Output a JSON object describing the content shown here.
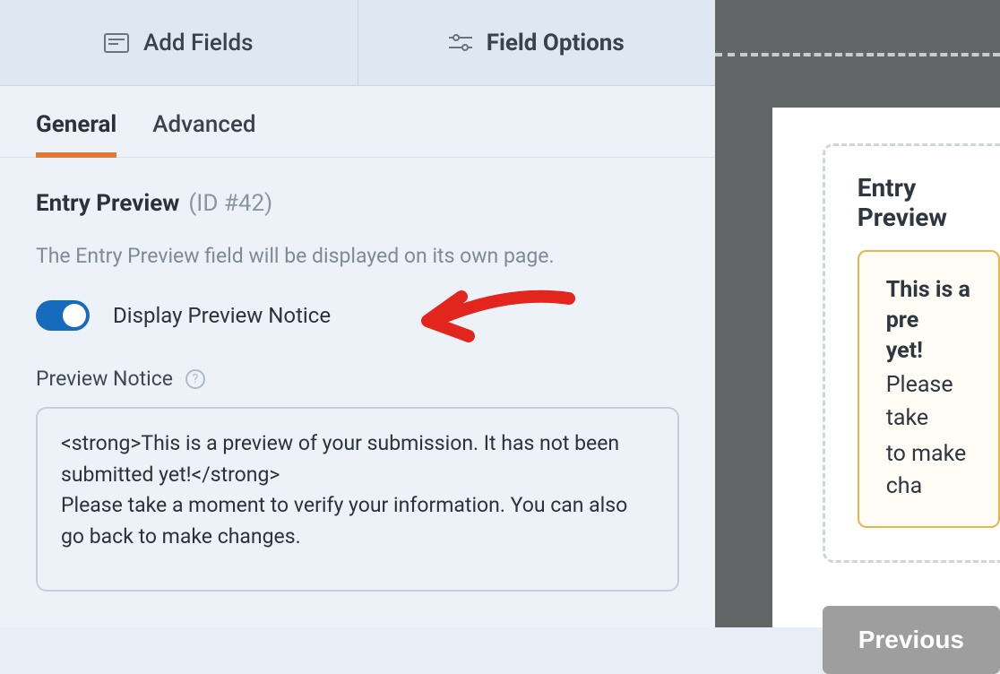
{
  "top_tabs": {
    "add_fields": "Add Fields",
    "field_options": "Field Options"
  },
  "sub_tabs": {
    "general": "General",
    "advanced": "Advanced"
  },
  "section": {
    "title": "Entry Preview",
    "id_label": "(ID #42)"
  },
  "description": "The Entry Preview field will be displayed on its own page.",
  "toggle": {
    "label": "Display Preview Notice"
  },
  "notice_field": {
    "label": "Preview Notice",
    "value": "<strong>This is a preview of your submission. It has not been submitted yet!</strong>\nPlease take a moment to verify your information. You can also go back to make changes."
  },
  "preview": {
    "heading": "Entry Preview",
    "notice_bold_line1": "This is a pre",
    "notice_bold_line2": "yet!",
    "notice_line3": "Please take",
    "notice_line4": "to make cha",
    "previous_button": "Previous"
  }
}
